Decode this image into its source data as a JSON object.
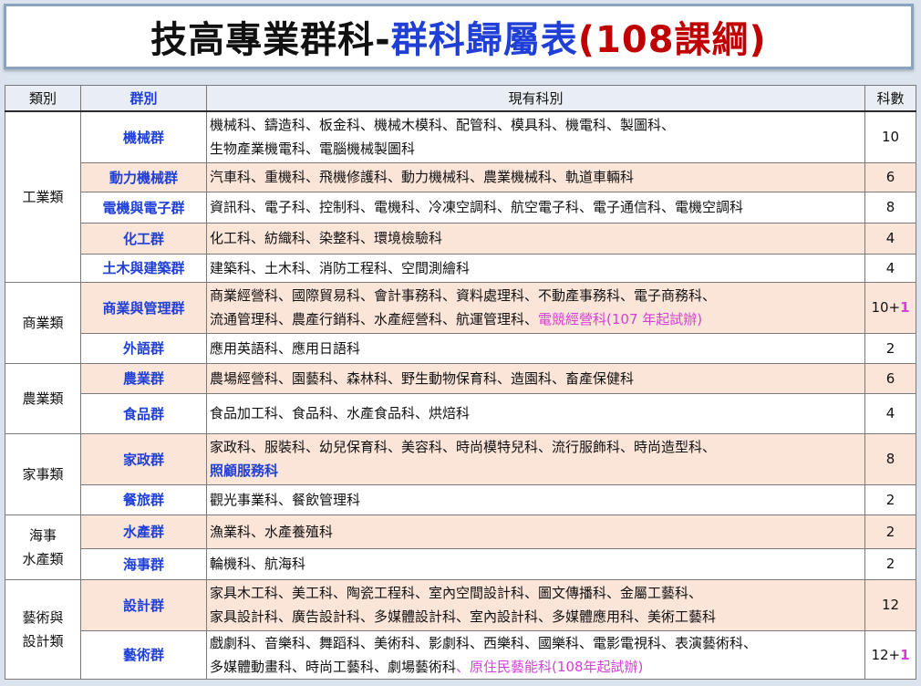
{
  "title": {
    "part1": "技高專業群科-",
    "part2": "群科歸屬表",
    "part3": "(108課綱)"
  },
  "headers": {
    "category": "類別",
    "group": "群別",
    "departments": "現有科別",
    "count": "科數"
  },
  "rows": [
    {
      "category": "工業類",
      "group": "機械群",
      "line1": "機械科、鑄造科、板金科、機械木模科、配管科、模具科、機電科、製圖科、",
      "line2": "生物產業機電科、電腦機械製圖科",
      "count": "10"
    },
    {
      "group": "動力機械群",
      "line1": "汽車科、重機科、飛機修護科、動力機械科、農業機械科、軌道車輛科",
      "count": "6"
    },
    {
      "group": "電機與電子群",
      "line1": "資訊科、電子科、控制科、電機科、冷凍空調科、航空電子科、電子通信科、電機空調科",
      "count": "8"
    },
    {
      "group": "化工群",
      "line1": "化工科、紡織科、染整科、環境檢驗科",
      "count": "4"
    },
    {
      "group": "土木與建築群",
      "line1": "建築科、土木科、消防工程科、空間測繪科",
      "count": "4"
    },
    {
      "category": "商業類",
      "group": "商業與管理群",
      "line1": "商業經營科、國際貿易科、會計事務科、資料處理科、不動產事務科、電子商務科、",
      "line2": "流通管理科、農產行銷科、水產經營科、航運管理科、",
      "line2_hl": "電競經營科(107 年起試辦)",
      "count": "10+",
      "count_plus": "1"
    },
    {
      "group": "外語群",
      "line1": "應用英語科、應用日語科",
      "count": "2"
    },
    {
      "category": "農業類",
      "group": "農業群",
      "line1": "農場經營科、園藝科、森林科、野生動物保育科、造園科、畜產保健科",
      "count": "6"
    },
    {
      "group": "食品群",
      "line1": "食品加工科、食品科、水產食品科、烘焙科",
      "count": "4"
    },
    {
      "category": "家事類",
      "group": "家政群",
      "line1": "家政科、服裝科、幼兒保育科、美容科、時尚模特兒科、流行服飾科、時尚造型科、",
      "line2_hl": "照顧服務科",
      "count": "8"
    },
    {
      "group": "餐旅群",
      "line1": "觀光事業科、餐飲管理科",
      "count": "2"
    },
    {
      "category_line1": "海事",
      "category_line2": "水產類",
      "group": "水產群",
      "line1": "漁業科、水產養殖科",
      "count": "2"
    },
    {
      "group": "海事群",
      "line1": "輪機科、航海科",
      "count": "2"
    },
    {
      "category_line1": "藝術與",
      "category_line2": "設計類",
      "group": "設計群",
      "line1": "家具木工科、美工科、陶瓷工程科、室內空間設計科、圖文傳播科、金屬工藝科、",
      "line2": "家具設計科、廣告設計科、多媒體設計科、室內設計科、多媒體應用科、美術工藝科",
      "count": "12"
    },
    {
      "group": "藝術群",
      "line1": "戲劇科、音樂科、舞蹈科、美術科、影劇科、西樂科、國樂科、電影電視科、表演藝術科、",
      "line2": "多媒體動畫科、時尚工藝科、劇場藝術科",
      "line2_hl": "、原住民藝能科(108年起試辦)",
      "count": "12+",
      "count_plus": "1"
    }
  ]
}
